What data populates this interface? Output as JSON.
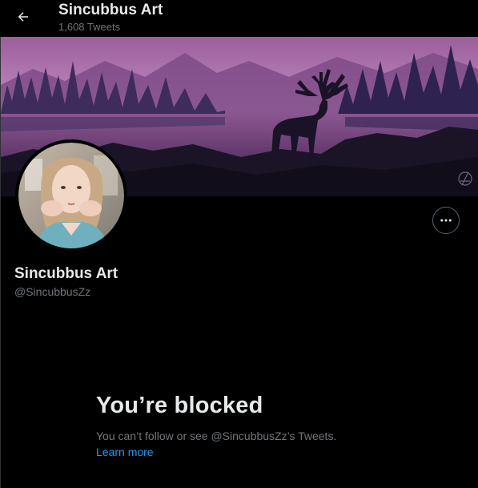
{
  "header": {
    "title": "Sincubbus Art",
    "subtitle": "1,608 Tweets",
    "back_icon": "arrow-left-icon"
  },
  "profile": {
    "name": "Sincubbus Art",
    "handle": "@SincubbusZz",
    "more_icon": "more-horizontal-icon"
  },
  "blocked": {
    "title": "You’re blocked",
    "message": "You can’t follow or see @SincubbusZz’s Tweets.",
    "link": "Learn more"
  },
  "colors": {
    "background": "#000000",
    "text_primary": "#e7e9ea",
    "text_secondary": "#71767b",
    "link": "#1d9bf0",
    "banner_sky": "#b77bb3"
  }
}
